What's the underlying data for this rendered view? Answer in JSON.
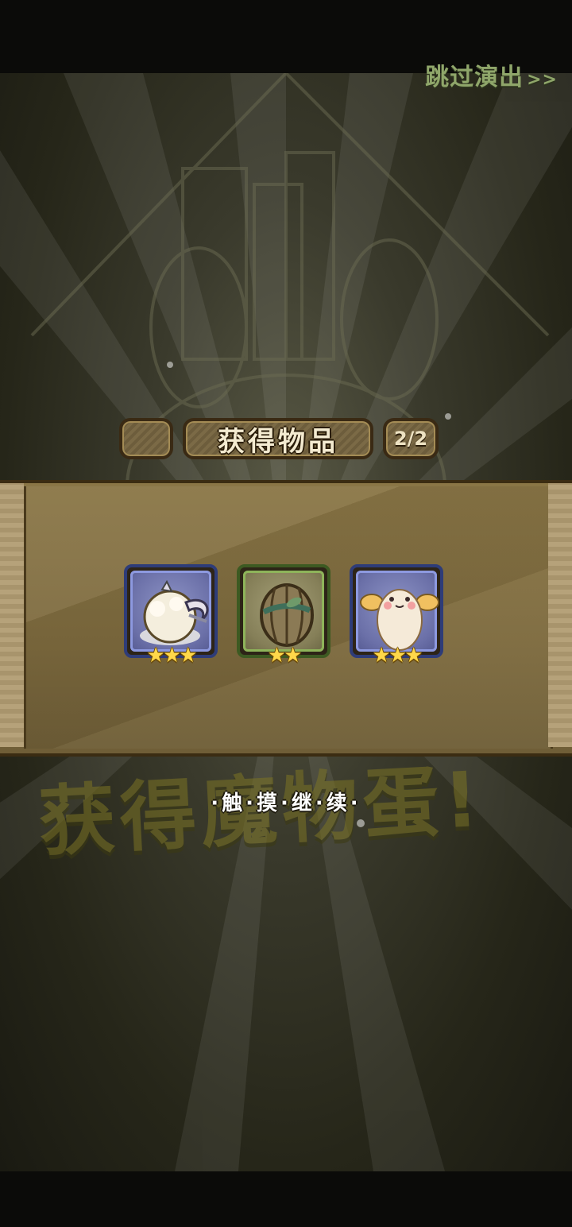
{
  "header": {
    "skip_label": "跳过演出",
    "skip_arrows": ">>"
  },
  "title_bar": {
    "title": "获得物品",
    "counter": "2/2"
  },
  "items": [
    {
      "name": "horned-fluff-creature-icon",
      "frame": "blue",
      "stars": 3,
      "stars_text": "★★★"
    },
    {
      "name": "striped-egg-icon",
      "frame": "green",
      "stars": 2,
      "stars_text": "★★"
    },
    {
      "name": "winged-fluff-creature-icon",
      "frame": "blue",
      "stars": 3,
      "stars_text": "★★★"
    }
  ],
  "banner": {
    "text": "获得魔物蛋!"
  },
  "prompt": {
    "text": "·触·摸·继·续·"
  },
  "colors": {
    "skip_text": "#8fa66a",
    "star": "#ffd84a",
    "blue_frame": "#8d99e0",
    "green_frame": "#8eb45a"
  }
}
